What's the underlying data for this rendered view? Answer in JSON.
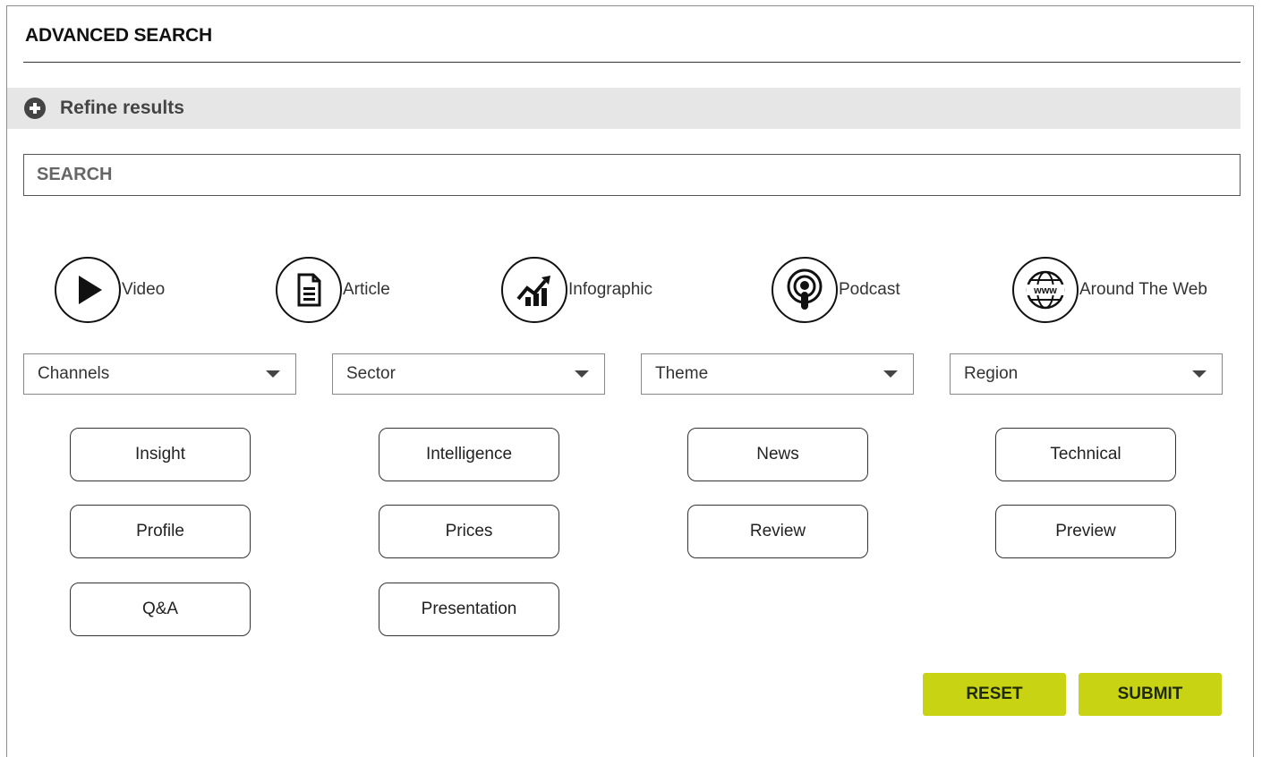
{
  "header": {
    "title": "ADVANCED SEARCH"
  },
  "refine": {
    "label": "Refine results",
    "icon": "plus-circle-icon"
  },
  "search": {
    "placeholder": "SEARCH",
    "value": ""
  },
  "content_types": [
    {
      "label": "Video",
      "icon": "play-icon"
    },
    {
      "label": "Article",
      "icon": "document-icon"
    },
    {
      "label": "Infographic",
      "icon": "chart-trend-icon"
    },
    {
      "label": "Podcast",
      "icon": "podcast-icon"
    },
    {
      "label": "Around The Web",
      "icon": "globe-www-icon"
    }
  ],
  "filters": [
    {
      "label": "Channels"
    },
    {
      "label": "Sector"
    },
    {
      "label": "Theme"
    },
    {
      "label": "Region"
    }
  ],
  "tags": [
    "Insight",
    "Intelligence",
    "News",
    "Technical",
    "Profile",
    "Prices",
    "Review",
    "Preview",
    "Q&A",
    "Presentation"
  ],
  "actions": {
    "reset_label": "RESET",
    "submit_label": "SUBMIT"
  },
  "colors": {
    "accent": "#c8d314",
    "refine_bar": "#e6e6e6"
  }
}
